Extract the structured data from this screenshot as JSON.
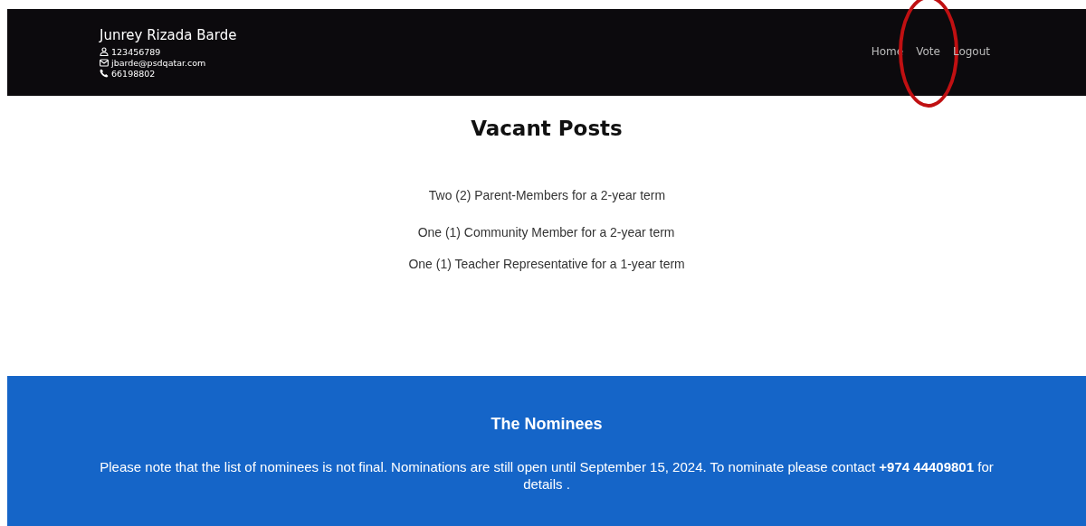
{
  "header": {
    "name": "Junrey Rizada Barde",
    "details": [
      {
        "kind": "id",
        "text": "123456789"
      },
      {
        "kind": "email",
        "text": "jbarde@psdqatar.com"
      },
      {
        "kind": "phone",
        "text": "66198802"
      }
    ],
    "nav": [
      {
        "label": "Home",
        "circled": false
      },
      {
        "label": "Vote",
        "circled": true
      },
      {
        "label": "Logout",
        "circled": false
      }
    ]
  },
  "vacant_posts": {
    "title": "Vacant Posts",
    "items": [
      "Two (2) Parent-Members for a 2-year term",
      "One (1) Community Member for a 2-year term",
      "One (1) Teacher Representative for a 1-year term"
    ]
  },
  "nominees": {
    "title": "The Nominees",
    "note": "Please note that the list of nominees is not final.  Nominations are still open until September 15, 2024. To nominate please contact **+974 44409801** for details ."
  }
}
